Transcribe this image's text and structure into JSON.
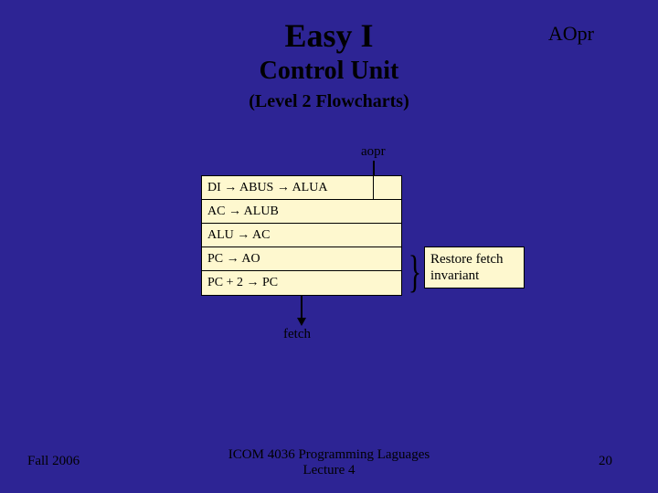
{
  "title": "Easy I",
  "subtitle": "Control Unit",
  "subtitle2": "(Level 2 Flowcharts)",
  "aopr_label": "AOpr",
  "entry_label": "aopr",
  "block_rows": [
    "DI → ABUS → ALUA",
    "AC → ALUB",
    "ALU → AC",
    "PC → AO",
    "PC + 2 → PC"
  ],
  "note_lines": [
    "Restore fetch",
    "invariant"
  ],
  "fetch_label": "fetch",
  "footer_left": "Fall 2006",
  "footer_center": "ICOM 4036 Programming Laguages\nLecture 4",
  "footer_right": "20"
}
